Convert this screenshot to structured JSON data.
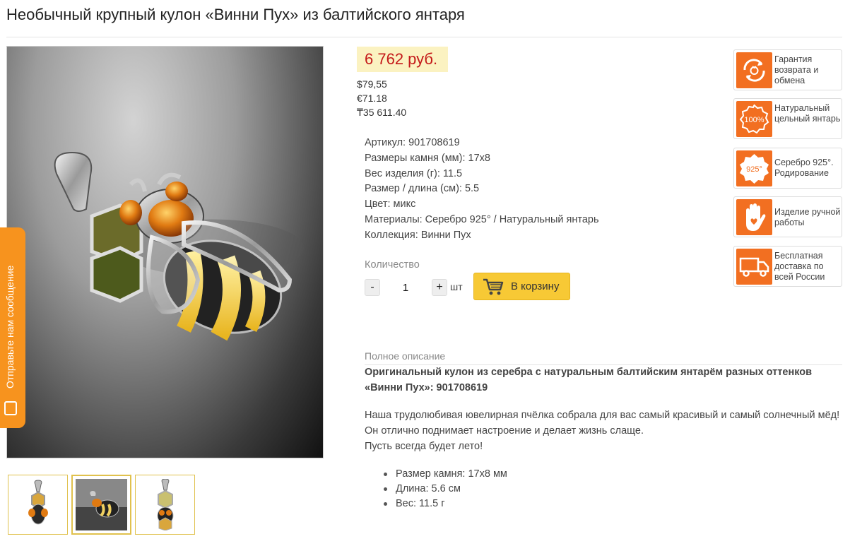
{
  "title": "Необычный крупный кулон «Винни Пух» из балтийского янтаря",
  "side_tab": {
    "label": "Отправьте нам сообщение"
  },
  "price": {
    "main": "6 762 руб.",
    "usd": "$79,55",
    "eur": "€71.18",
    "kzt": "₸35 611.40",
    "color": "#c41a1a"
  },
  "specs": [
    {
      "key": "Артикул:",
      "value": "901708619"
    },
    {
      "key": "Размеры камня (мм):",
      "value": "17х8"
    },
    {
      "key": "Вес изделия (г):",
      "value": "11.5"
    },
    {
      "key": "Размер / длина (см):",
      "value": "5.5"
    },
    {
      "key": "Цвет:",
      "value": "микс"
    },
    {
      "key": "Материалы:",
      "value": "Серебро 925° / Натуральный янтарь"
    },
    {
      "key": "Коллекция:",
      "value": "Винни Пух"
    }
  ],
  "quantity": {
    "label": "Количество",
    "minus": "-",
    "plus": "+",
    "value": "1",
    "unit": "шт"
  },
  "cart_button": {
    "label": "В корзину",
    "color": "#f7c935"
  },
  "description": {
    "label": "Полное описание",
    "heading": "Оригинальный кулон из серебра с натуральным балтийским янтарём разных оттенков «Винни Пух»: 901708619",
    "body_line1": "Наша трудолюбивая ювелирная пчёлка собрала для вас самый красивый и самый солнечный мёд! Он отлично поднимает настроение и делает жизнь слаще.",
    "body_line2": "Пусть всегда будет лето!",
    "bullets": [
      "Размер камня: 17х8 мм",
      "Длина: 5.6  см",
      "Вес: 11.5 г"
    ]
  },
  "badges": [
    {
      "icon": "refresh-ring-icon",
      "text": "Гарантия возврата и обмена"
    },
    {
      "icon": "natural-100-icon",
      "text": "Натуральный цельный янтарь",
      "icon_text": "100%"
    },
    {
      "icon": "silver-925-icon",
      "text": "Серебро 925°. Родирование",
      "icon_text": "925°"
    },
    {
      "icon": "hand-heart-icon",
      "text": "Изделие ручной работы"
    },
    {
      "icon": "truck-icon",
      "text": "Бесплатная доставка по всей России"
    }
  ],
  "accent_color": "#f26f21"
}
